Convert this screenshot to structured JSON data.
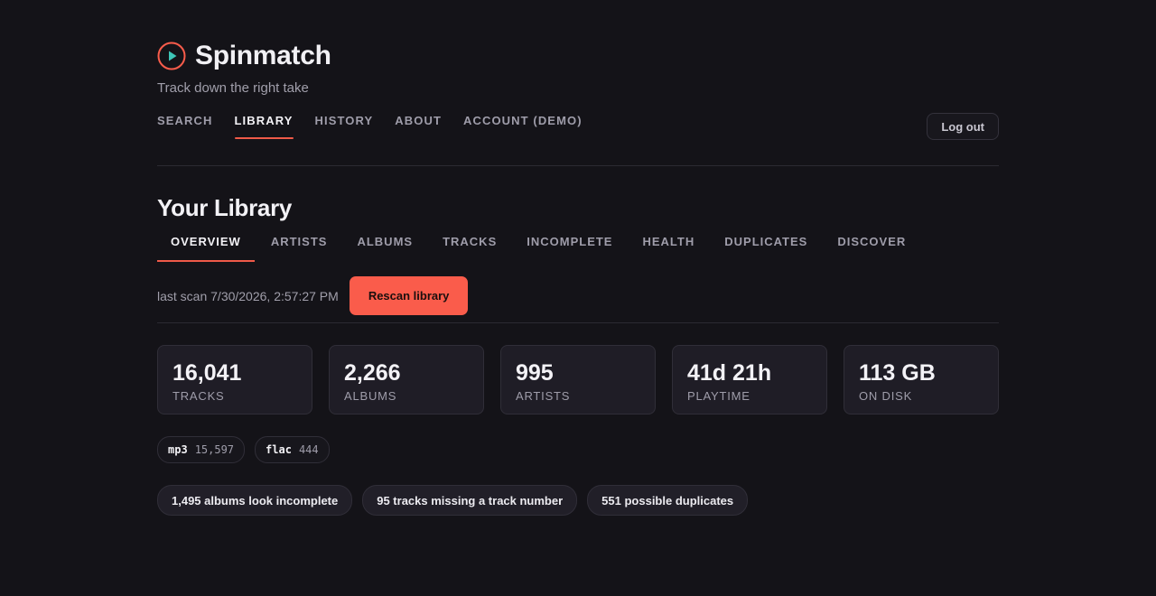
{
  "app": {
    "title": "Spinmatch",
    "tagline": "Track down the right take",
    "logo_icon": "play-circle-icon",
    "accent_color": "#fa5c4b",
    "play_color": "#3ec6b8"
  },
  "topnav": {
    "items": [
      {
        "id": "search",
        "label": "SEARCH"
      },
      {
        "id": "library",
        "label": "LIBRARY",
        "active": true
      },
      {
        "id": "history",
        "label": "HISTORY"
      },
      {
        "id": "about",
        "label": "ABOUT"
      },
      {
        "id": "account",
        "label": "ACCOUNT (DEMO)"
      }
    ],
    "logout_label": "Log out"
  },
  "library": {
    "title": "Your Library",
    "tabs": [
      {
        "id": "overview",
        "label": "OVERVIEW",
        "active": true
      },
      {
        "id": "artists",
        "label": "ARTISTS"
      },
      {
        "id": "albums",
        "label": "ALBUMS"
      },
      {
        "id": "tracks",
        "label": "TRACKS"
      },
      {
        "id": "incomplete",
        "label": "INCOMPLETE"
      },
      {
        "id": "health",
        "label": "HEALTH"
      },
      {
        "id": "duplicates",
        "label": "DUPLICATES"
      },
      {
        "id": "discover",
        "label": "DISCOVER"
      }
    ],
    "last_scan": "last scan 7/30/2026, 2:57:27 PM",
    "rescan_label": "Rescan library",
    "stats": [
      {
        "value": "16,041",
        "label": "TRACKS"
      },
      {
        "value": "2,266",
        "label": "ALBUMS"
      },
      {
        "value": "995",
        "label": "ARTISTS"
      },
      {
        "value": "41d 21h",
        "label": "PLAYTIME"
      },
      {
        "value": "113 GB",
        "label": "ON DISK"
      }
    ],
    "formats": [
      {
        "name": "mp3",
        "count": "15,597"
      },
      {
        "name": "flac",
        "count": "444"
      }
    ],
    "alerts": [
      {
        "id": "incomplete-albums",
        "label": "1,495 albums look incomplete"
      },
      {
        "id": "missing-track-number",
        "label": "95 tracks missing a track number"
      },
      {
        "id": "possible-duplicates",
        "label": "551 possible duplicates"
      }
    ]
  }
}
